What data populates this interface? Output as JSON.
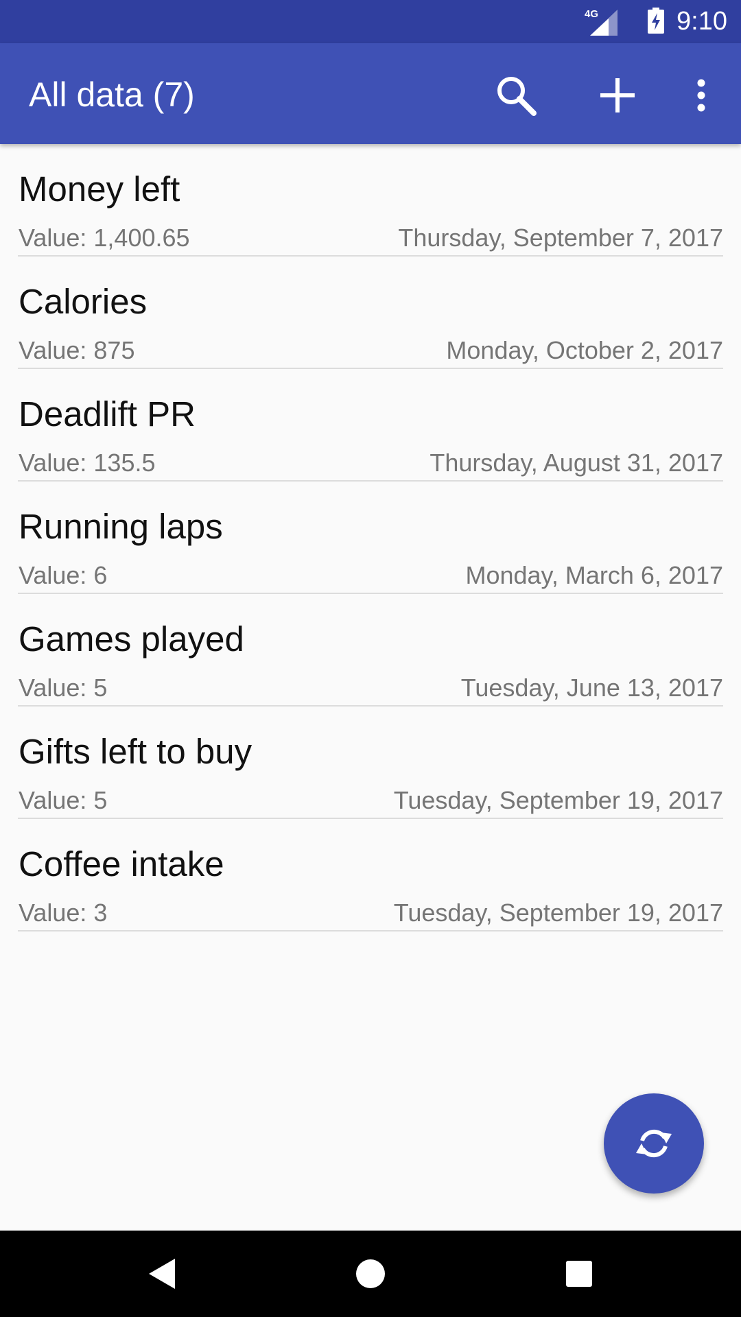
{
  "status_bar": {
    "network_label": "4G",
    "time": "9:10",
    "icons": [
      "signal-icon",
      "battery-charging-icon"
    ]
  },
  "app_bar": {
    "title": "All data (7)",
    "actions": [
      "search-icon",
      "add-icon",
      "more-vert-icon"
    ]
  },
  "items": [
    {
      "name": "Money left",
      "value": "Value: 1,400.65",
      "date": "Thursday, September 7, 2017"
    },
    {
      "name": "Calories",
      "value": "Value: 875",
      "date": "Monday, October 2, 2017"
    },
    {
      "name": "Deadlift PR",
      "value": "Value: 135.5",
      "date": "Thursday, August 31, 2017"
    },
    {
      "name": "Running laps",
      "value": "Value: 6",
      "date": "Monday, March 6, 2017"
    },
    {
      "name": "Games played",
      "value": "Value: 5",
      "date": "Tuesday, June 13, 2017"
    },
    {
      "name": "Gifts left to buy",
      "value": "Value: 5",
      "date": "Tuesday, September 19, 2017"
    },
    {
      "name": "Coffee intake",
      "value": "Value: 3",
      "date": "Tuesday, September 19, 2017"
    }
  ],
  "fab": {
    "icon": "sync-icon"
  },
  "colors": {
    "primary": "#3f51b5",
    "primary_dark": "#303f9f",
    "background": "#fafafa",
    "secondary_text": "#757575"
  },
  "nav_bar": {
    "icons": [
      "back-icon",
      "home-icon",
      "recents-icon"
    ]
  }
}
